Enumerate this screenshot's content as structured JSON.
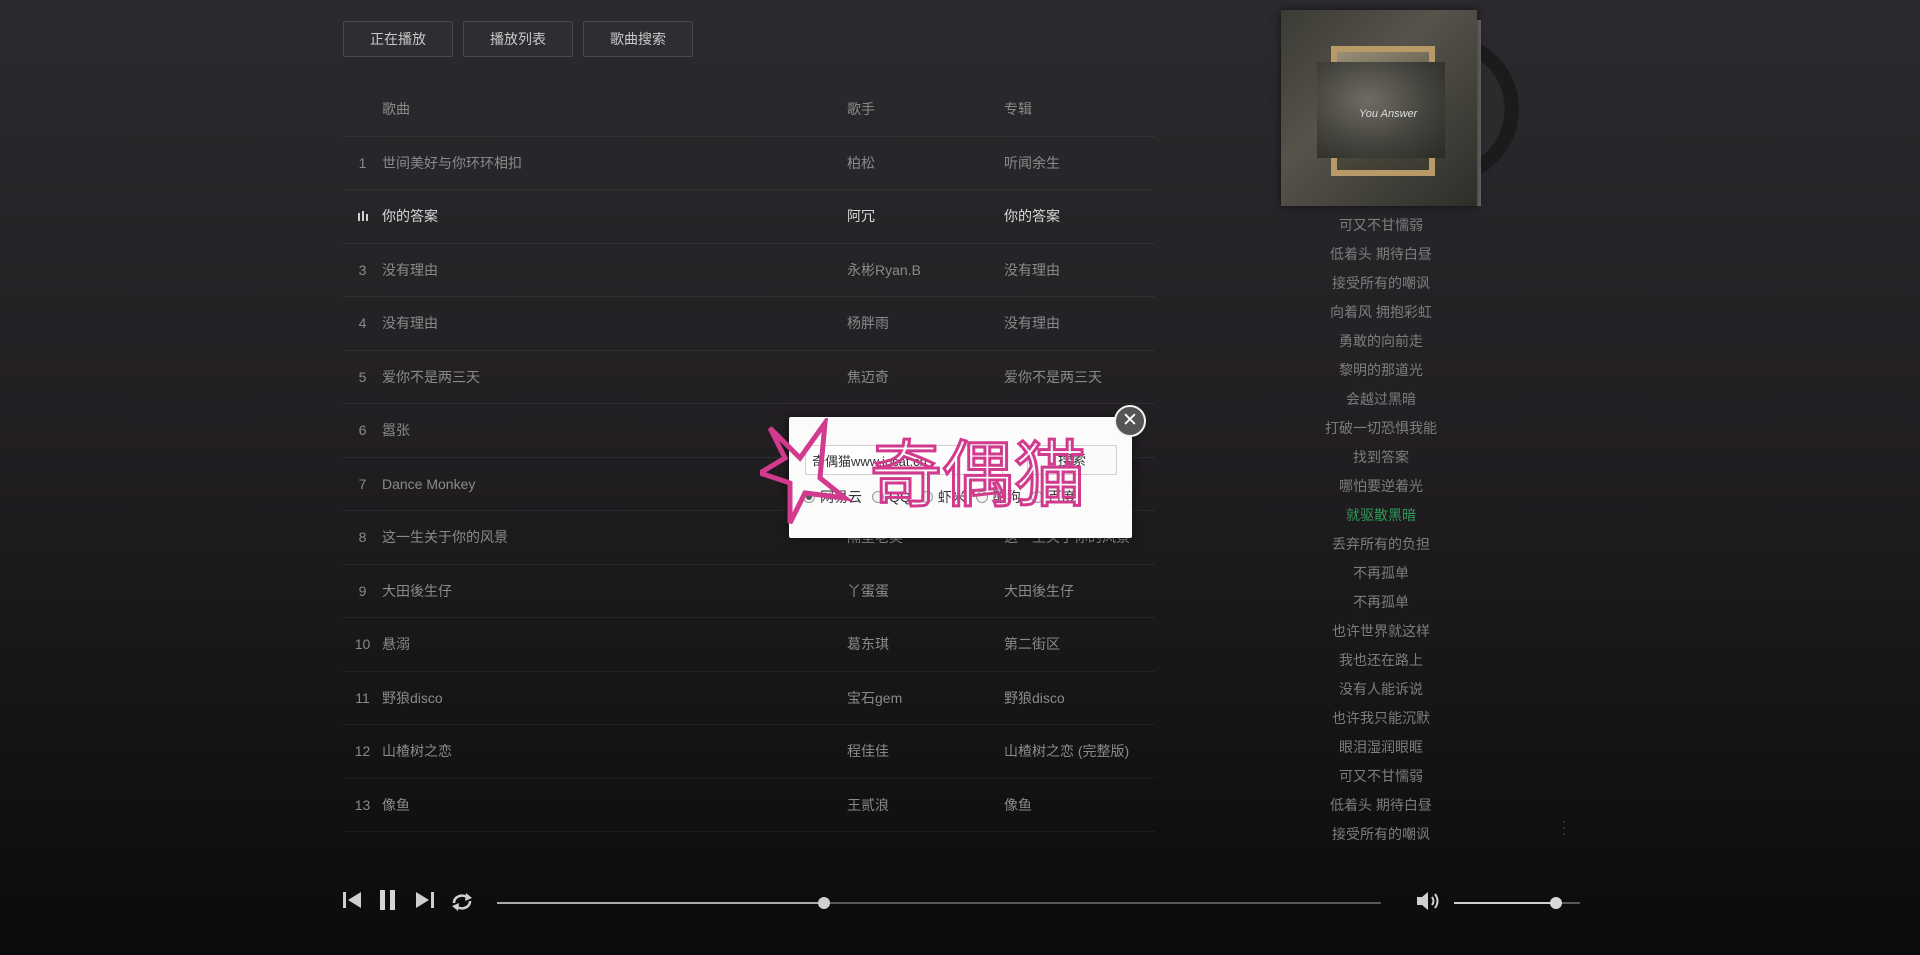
{
  "tabs": [
    "正在播放",
    "播放列表",
    "歌曲搜索"
  ],
  "table": {
    "headers": {
      "song": "歌曲",
      "artist": "歌手",
      "album": "专辑"
    },
    "rows": [
      {
        "no": "1",
        "song": "世间美好与你环环相扣",
        "artist": "柏松",
        "album": "听闻余生"
      },
      {
        "no": "2",
        "song": "你的答案",
        "artist": "阿冗",
        "album": "你的答案"
      },
      {
        "no": "3",
        "song": "没有理由",
        "artist": "永彬Ryan.B",
        "album": "没有理由"
      },
      {
        "no": "4",
        "song": "没有理由",
        "artist": "杨胖雨",
        "album": "没有理由"
      },
      {
        "no": "5",
        "song": "爱你不是两三天",
        "artist": "焦迈奇",
        "album": "爱你不是两三天"
      },
      {
        "no": "6",
        "song": "嚣张",
        "artist": "",
        "album": ""
      },
      {
        "no": "7",
        "song": "Dance Monkey",
        "artist": "",
        "album": ""
      },
      {
        "no": "8",
        "song": "这一生关于你的风景",
        "artist": "隔壁老樊",
        "album": "这一生关于你的风景"
      },
      {
        "no": "9",
        "song": "大田後生仔",
        "artist": "丫蛋蛋",
        "album": "大田後生仔"
      },
      {
        "no": "10",
        "song": "悬溺",
        "artist": "葛东琪",
        "album": "第二街区"
      },
      {
        "no": "11",
        "song": "野狼disco",
        "artist": "宝石gem",
        "album": "野狼disco"
      },
      {
        "no": "12",
        "song": "山楂树之恋",
        "artist": "程佳佳",
        "album": "山楂树之恋 (完整版)"
      },
      {
        "no": "13",
        "song": "像鱼",
        "artist": "王贰浪",
        "album": "像鱼"
      }
    ],
    "playing_index": 1
  },
  "album_cover_text": "You Answer",
  "lyrics": [
    "可又不甘懦弱",
    "低着头 期待白昼",
    "接受所有的嘲讽",
    "向着风 拥抱彩虹",
    "勇敢的向前走",
    "黎明的那道光",
    "会越过黑暗",
    "打破一切恐惧我能",
    "找到答案",
    "哪怕要逆着光",
    "就驱散黑暗",
    "丢弃所有的负担",
    "不再孤单",
    "不再孤单",
    "也许世界就这样",
    "我也还在路上",
    "没有人能诉说",
    "也许我只能沉默",
    "眼泪湿润眼眶",
    "可又不甘懦弱",
    "低着头 期待白昼",
    "接受所有的嘲讽"
  ],
  "current_lyric_index": 10,
  "player": {
    "progress": 0.37,
    "volume": 0.81,
    "icons": [
      "prev-icon",
      "pause-icon",
      "next-icon",
      "loop-icon",
      "volume-icon"
    ]
  },
  "search_dialog": {
    "input_value": "奇偶猫www.jocat.cn",
    "button_label": "搜索",
    "sources": [
      "网易云",
      "QQ",
      "虾米",
      "酷狗",
      "百度"
    ],
    "selected_source": 0,
    "close_symbol": "✕"
  },
  "colors": {
    "accent_lyric": "#2f9b58",
    "watermark": "#d23a8e"
  },
  "watermark": {
    "text": "奇偶猫"
  }
}
